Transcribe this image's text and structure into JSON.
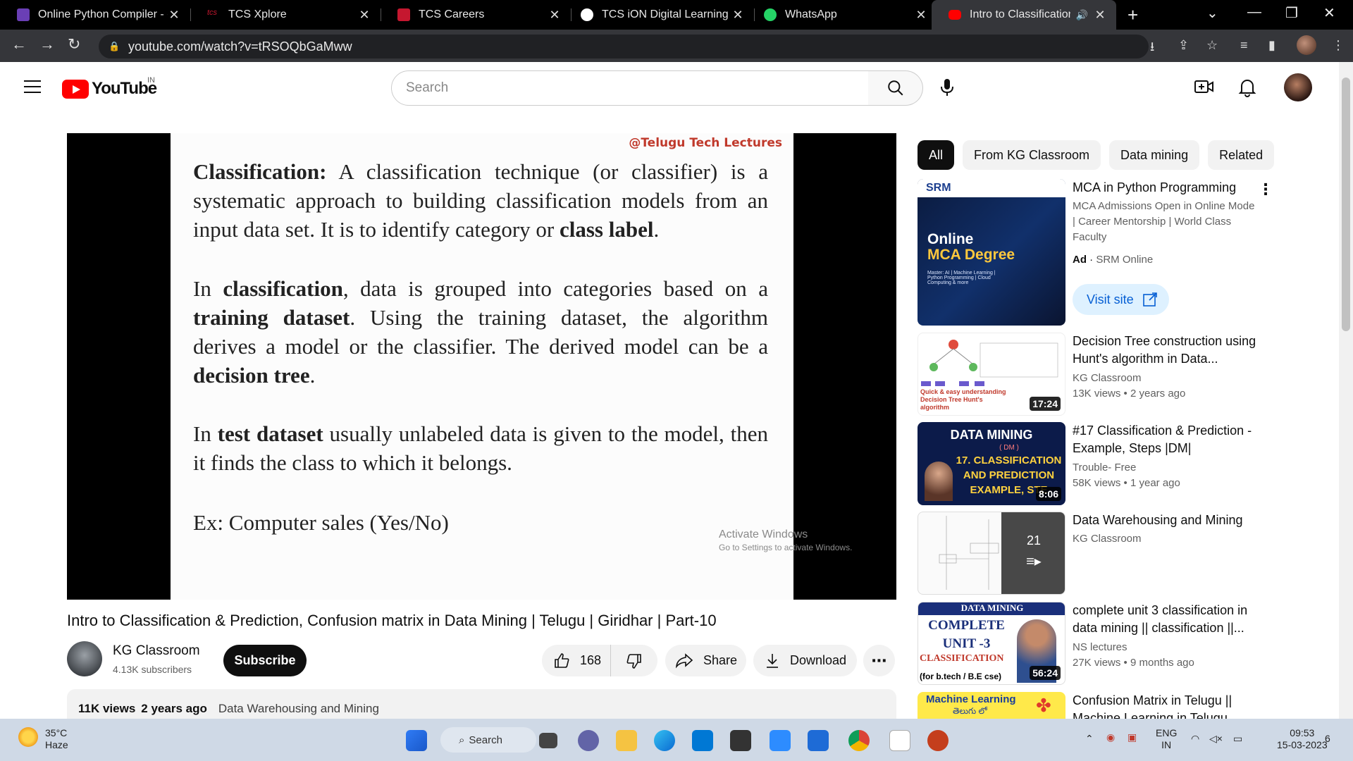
{
  "browser": {
    "tabs": [
      {
        "title": "Online Python Compiler - o",
        "color": "#6a3fb5"
      },
      {
        "title": "TCS Xplore",
        "color": "#c5172f"
      },
      {
        "title": "TCS Careers",
        "color": "#c5172f"
      },
      {
        "title": "TCS iON Digital Learning",
        "color": "#ffffff"
      },
      {
        "title": "WhatsApp",
        "color": "#25d366"
      },
      {
        "title": "Intro to Classification &",
        "color": "#ff0000"
      }
    ],
    "url": "youtube.com/watch?v=tRSOQbGaMww"
  },
  "header": {
    "logo_text": "YouTube",
    "country": "IN",
    "search_placeholder": "Search"
  },
  "slide": {
    "watermark": "@Telugu Tech Lectures",
    "p1_b1": "Classification:",
    "p1_t1": " A classification technique (or classifier) is a systematic approach to building classification models from an input data set. It is to identify category or ",
    "p1_b2": "class label",
    "p1_t2": ".",
    "p2_t1": "In ",
    "p2_b1": "classification",
    "p2_t2": ", data is grouped into categories based on a ",
    "p2_b2": "training dataset",
    "p2_t3": ". Using the training dataset, the algorithm derives a model or the classifier.  The derived model can be a ",
    "p2_b3": "decision tree",
    "p2_t4": ".",
    "p3_t1": "In ",
    "p3_b1": "test dataset",
    "p3_t2": " usually unlabeled data is given to the model, then it finds the class to which it belongs.",
    "p4": "Ex: Computer sales (Yes/No)"
  },
  "activation": {
    "line1": "Activate Windows",
    "line2": "Go to Settings to activate Windows."
  },
  "video": {
    "title": "Intro to Classification & Prediction, Confusion matrix in Data Mining | Telugu | Giridhar | Part-10",
    "channel": "KG Classroom",
    "subscribers": "4.13K subscribers",
    "subscribe_label": "Subscribe",
    "likes": "168",
    "share_label": "Share",
    "download_label": "Download",
    "views": "11K views",
    "age": "2 years ago",
    "playlist_tag": "Data Warehousing and Mining"
  },
  "chips": [
    "All",
    "From KG Classroom",
    "Data mining",
    "Related"
  ],
  "ad": {
    "title": "MCA in Python Programming",
    "desc": "MCA Admissions Open in Online Mode | Career Mentorship | World Class Faculty",
    "ad_label": "Ad",
    "advertiser": "SRM Online",
    "visit_label": "Visit site",
    "thumb_brand": "SRM",
    "thumb_line1": "Online",
    "thumb_line2": "MCA Degree",
    "thumb_small": "Master: AI | Machine Learning | Python Programming | Cloud Computing & more"
  },
  "recommendations": [
    {
      "title": "Decision Tree construction using Hunt's algorithm in Data...",
      "channel": "KG Classroom",
      "views": "13K views",
      "age": "2 years ago",
      "duration": "17:24",
      "thumb_text": "Quick & easy understanding Decision Tree Hunt's algorithm"
    },
    {
      "title": "#17 Classification & Prediction - Example, Steps |DM|",
      "channel": "Trouble- Free",
      "views": "58K views",
      "age": "1 year ago",
      "duration": "8:06",
      "thumb_text": "DATA MINING",
      "thumb_sub": "( DM )",
      "thumb_main": "17. CLASSIFICATION AND PREDICTION EXAMPLE, STE"
    },
    {
      "title": "Data Warehousing and Mining",
      "channel": "KG Classroom",
      "count": "21"
    },
    {
      "title": "complete unit 3 classification in data mining || classification ||...",
      "channel": "NS lectures",
      "views": "27K views",
      "age": "9 months ago",
      "duration": "56:24",
      "thumb_text": "DATA MINING",
      "thumb_main": "COMPLETE UNIT -3",
      "thumb_sub": "CLASSIFICATION",
      "thumb_foot": "(for b.tech / B.E cse)"
    },
    {
      "title": "Confusion Matrix in Telugu || Machine Learning in Telugu",
      "thumb_text": "Machine Learning",
      "thumb_sub": "తెలుగు లో"
    }
  ],
  "taskbar": {
    "temp": "35°C",
    "condition": "Haze",
    "search_label": "Search",
    "lang1": "ENG",
    "lang2": "IN",
    "time": "09:53",
    "date": "15-03-2023",
    "notif": "6"
  }
}
